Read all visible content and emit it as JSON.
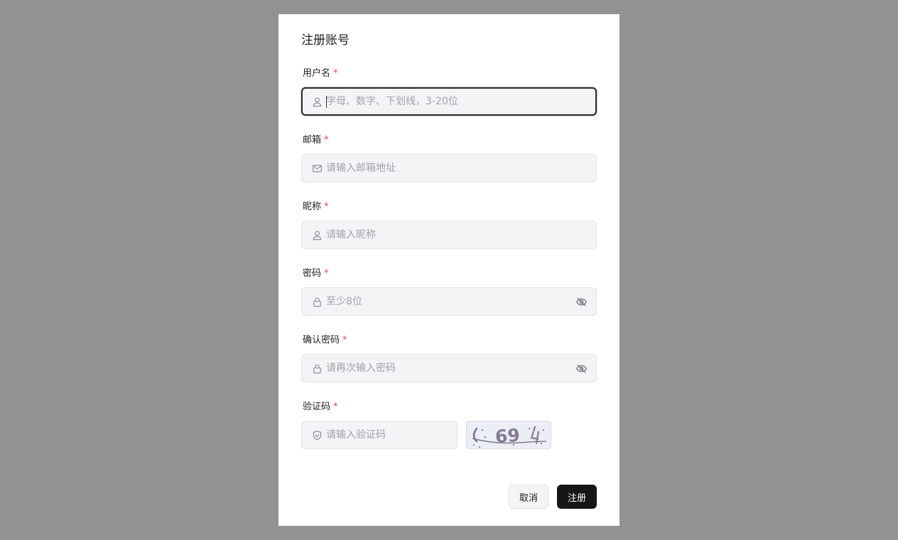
{
  "dialog": {
    "title": "注册账号",
    "required_mark": "*"
  },
  "fields": {
    "username": {
      "label": "用户名",
      "placeholder": "字母、数字、下划线，3-20位",
      "value": "",
      "icon": "user-icon"
    },
    "email": {
      "label": "邮箱",
      "placeholder": "请输入邮箱地址",
      "value": "",
      "icon": "mail-icon"
    },
    "nickname": {
      "label": "昵称",
      "placeholder": "请输入昵称",
      "value": "",
      "icon": "user-icon"
    },
    "password": {
      "label": "密码",
      "placeholder": "至少8位",
      "value": "",
      "icon": "lock-icon",
      "toggle_icon": "eye-off-icon"
    },
    "confirm_password": {
      "label": "确认密码",
      "placeholder": "请再次输入密码",
      "value": "",
      "icon": "lock-icon",
      "toggle_icon": "eye-off-icon"
    },
    "captcha": {
      "label": "验证码",
      "placeholder": "请输入验证码",
      "value": "",
      "icon": "shield-icon",
      "image_text": "69"
    }
  },
  "buttons": {
    "cancel": "取消",
    "submit": "注册"
  },
  "colors": {
    "overlay": "#929292",
    "primary_button": "#161616",
    "required": "#e5484d",
    "input_bg": "#f3f4f6"
  }
}
